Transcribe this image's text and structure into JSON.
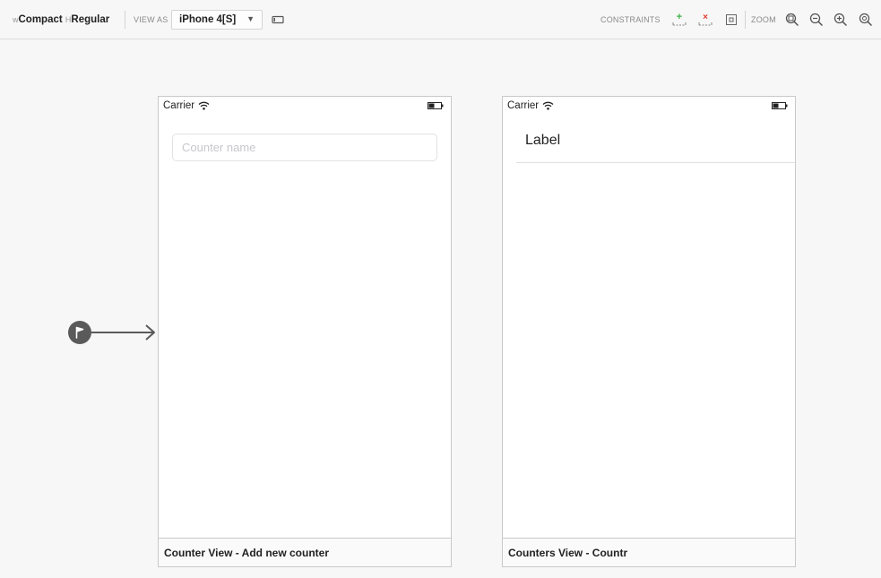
{
  "toolbar": {
    "size_class": {
      "width_prefix": "w",
      "width_value": "Compact",
      "height_prefix": "H",
      "height_value": "Regular"
    },
    "view_as_label": "VIEW AS",
    "device": "iPhone 4[S]",
    "constraints_label": "CONSTRAINTS",
    "zoom_label": "ZOOM",
    "icons": {
      "orientation": "device-orientation-icon",
      "add_constraint": "add-constraint-icon",
      "remove_constraint": "remove-constraint-icon",
      "update_frames": "update-frames-icon",
      "zoom_fit": "zoom-to-fit-icon",
      "zoom_out": "zoom-out-icon",
      "zoom_in": "zoom-in-icon",
      "zoom_actual": "zoom-actual-size-icon"
    }
  },
  "scenes": [
    {
      "status_carrier": "Carrier",
      "text_field_placeholder": "Counter name",
      "title": "Counter View - Add new counter",
      "is_initial": true
    },
    {
      "status_carrier": "Carrier",
      "cell_label": "Label",
      "title": "Counters View - Countr"
    }
  ],
  "colors": {
    "canvas": "#f7f7f7",
    "add_constraint": "#3bb24a",
    "remove_constraint": "#e03c31",
    "entry_arrow": "#5a5a5a"
  }
}
